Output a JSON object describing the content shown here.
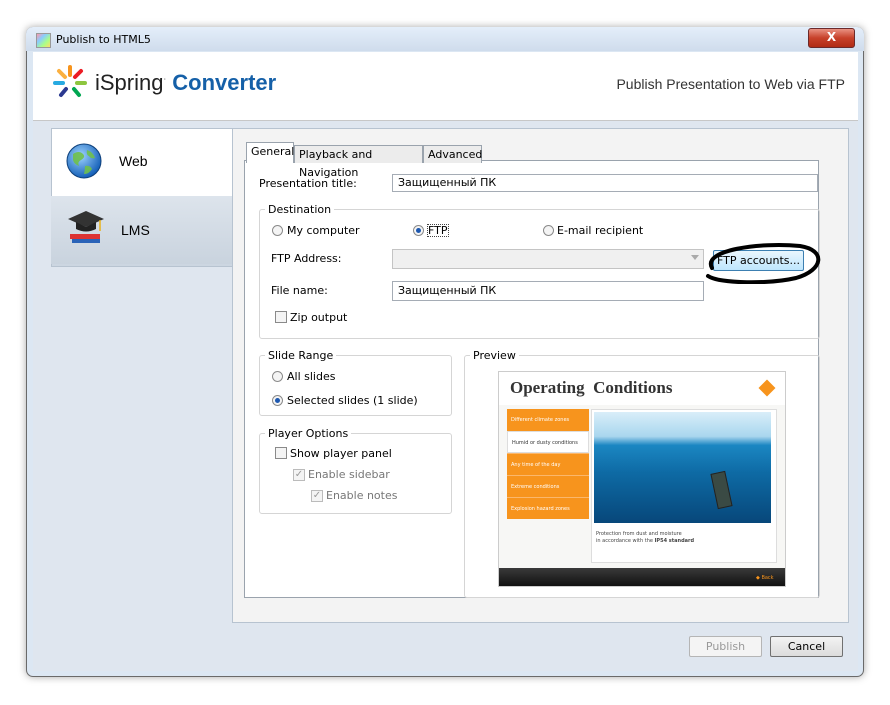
{
  "window": {
    "title": "Publish to HTML5",
    "close_symbol": "X"
  },
  "banner": {
    "brand_part1": "iSpring",
    "brand_part2": "Converter",
    "subtitle": "Publish Presentation to Web via FTP"
  },
  "nav": {
    "items": [
      {
        "label": "Web",
        "icon": "globe-icon"
      },
      {
        "label": "LMS",
        "icon": "graduation-cap-icon"
      }
    ]
  },
  "tabs": [
    {
      "label": "General"
    },
    {
      "label": "Playback and Navigation"
    },
    {
      "label": "Advanced"
    }
  ],
  "general": {
    "presentation_title_label": "Presentation title:",
    "presentation_title_value": "Защищенный ПК",
    "destination": {
      "legend": "Destination",
      "options": [
        "My computer",
        "FTP",
        "E-mail recipient"
      ],
      "selected": "FTP",
      "ftp_address_label": "FTP Address:",
      "ftp_address_value": "",
      "ftp_accounts_button": "FTP accounts...",
      "file_name_label": "File name:",
      "file_name_value": "Защищенный ПК",
      "zip_output_label": "Zip output"
    },
    "slide_range": {
      "legend": "Slide Range",
      "options": [
        "All slides",
        "Selected slides (1 slide)"
      ],
      "selected": "Selected slides (1 slide)"
    },
    "player_options": {
      "legend": "Player Options",
      "show_player_panel": "Show player panel",
      "enable_sidebar": "Enable sidebar",
      "enable_notes": "Enable notes"
    },
    "preview": {
      "legend": "Preview",
      "slide_title": "Operating  Conditions",
      "menu": [
        "Different climate zones",
        "Humid or dusty conditions",
        "Any time of the day",
        "Extreme conditions",
        "Explosion hazard zones"
      ],
      "caption_line1": "Protection from dust and moisture",
      "caption_line2_pre": "in accordance with the",
      "caption_line2_bold": "IP54 standard",
      "back_label": "Back"
    }
  },
  "footer": {
    "publish": "Publish",
    "cancel": "Cancel"
  },
  "colors": {
    "accent_orange": "#f7941d",
    "title_blue": "#1560a8"
  }
}
